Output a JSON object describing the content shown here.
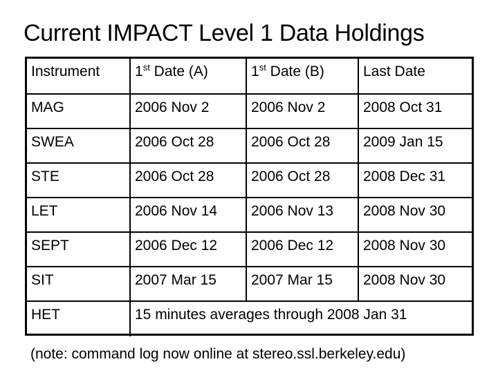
{
  "title": "Current IMPACT Level 1 Data Holdings",
  "table": {
    "headers": [
      {
        "pre": "",
        "text": "Instrument",
        "sup": ""
      },
      {
        "pre": "1",
        "sup": "st",
        "text": " Date (A)"
      },
      {
        "pre": "1",
        "sup": "st",
        "text": " Date (B)"
      },
      {
        "pre": "",
        "text": "Last Date",
        "sup": ""
      }
    ],
    "rows": [
      [
        "MAG",
        "2006 Nov 2",
        "2006 Nov 2",
        "2008 Oct 31"
      ],
      [
        "SWEA",
        "2006 Oct 28",
        "2006 Oct 28",
        "2009 Jan 15"
      ],
      [
        "STE",
        "2006 Oct 28",
        "2006 Oct 28",
        "2008 Dec 31"
      ],
      [
        "LET",
        "2006 Nov 14",
        "2006 Nov 13",
        "2008 Nov 30"
      ],
      [
        "SEPT",
        "2006 Dec 12",
        "2006 Dec 12",
        "2008 Nov 30"
      ],
      [
        "SIT",
        "2007 Mar 15",
        "2007 Mar 15",
        "2008 Nov 30"
      ]
    ],
    "last_row": {
      "instrument": "HET",
      "note": "15 minutes averages through 2008 Jan 31"
    }
  },
  "footnote": "(note: command log now online at stereo.ssl.berkeley.edu)"
}
